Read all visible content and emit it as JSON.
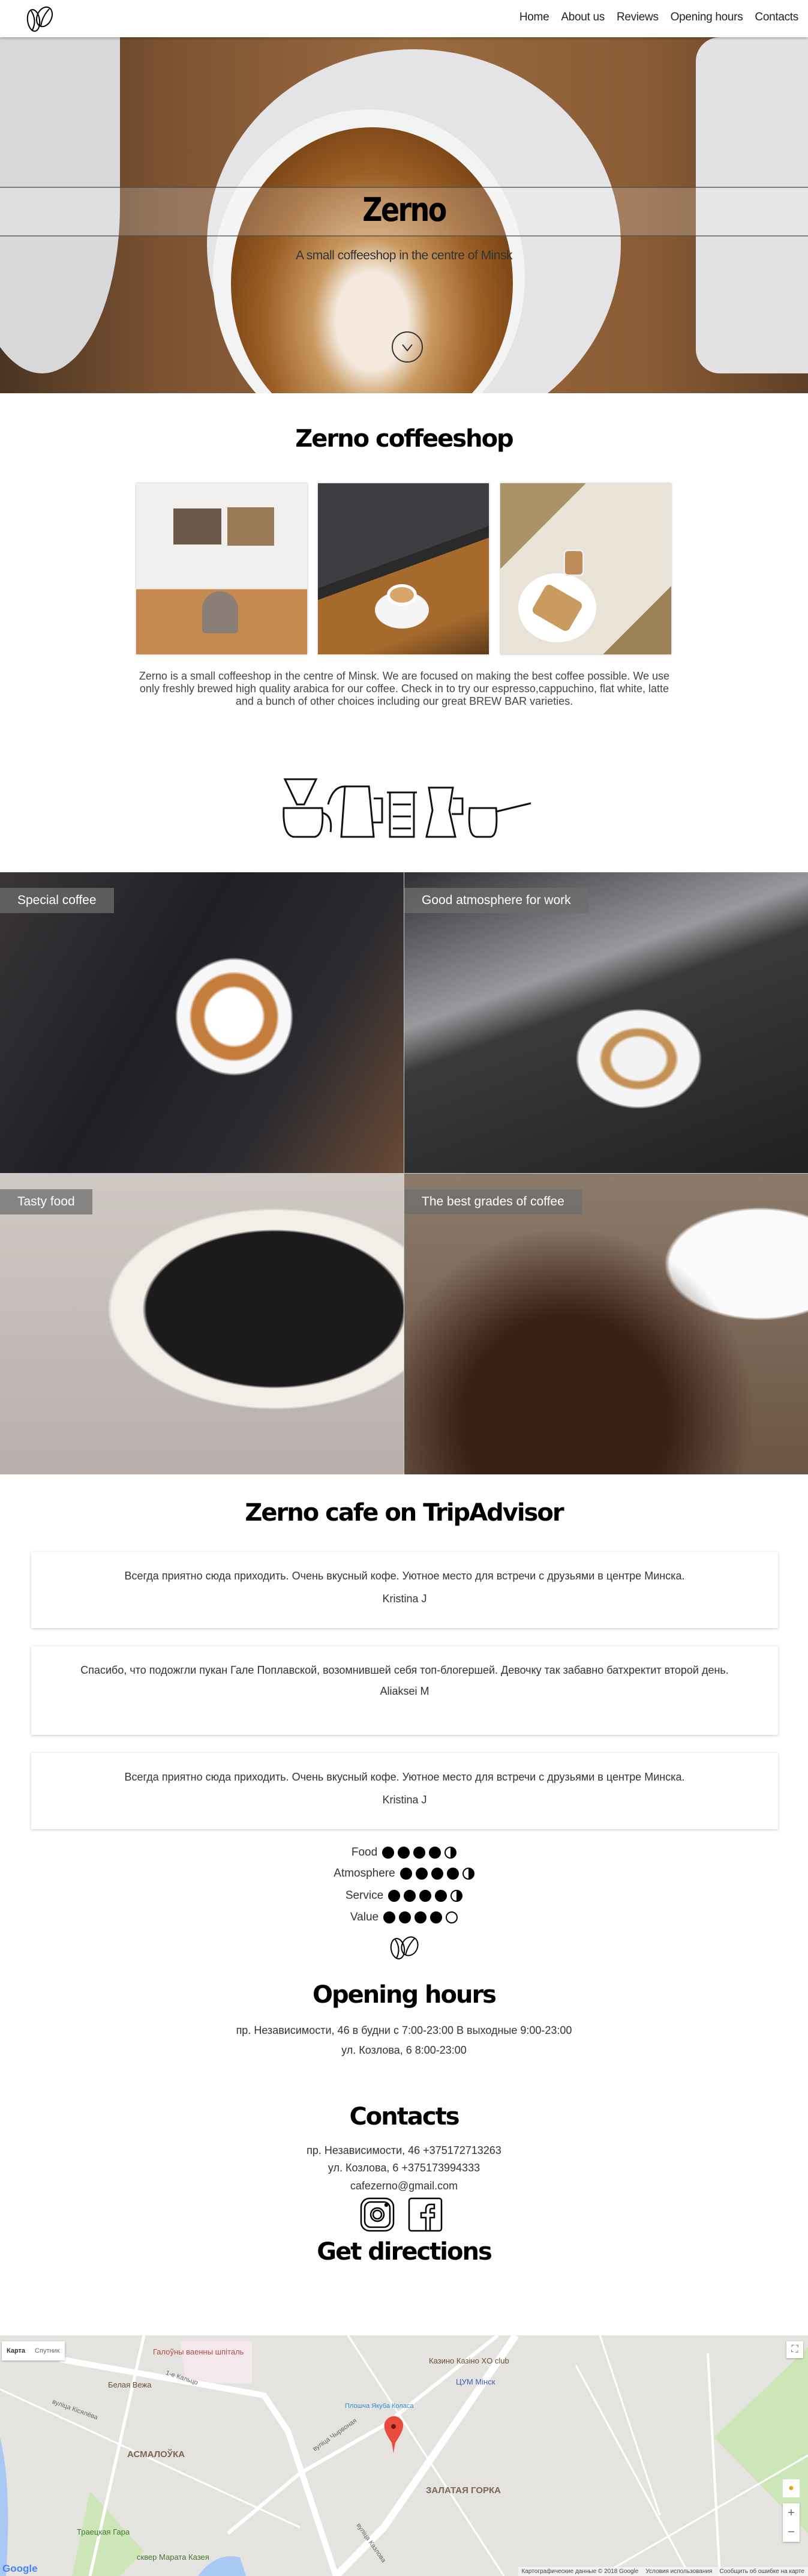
{
  "nav": {
    "logo": "coffee-bean-logo",
    "items": [
      "Home",
      "About us",
      "Reviews",
      "Opening hours",
      "Contacts"
    ]
  },
  "hero": {
    "title": "Zerno",
    "subtitle": "A small coffeeshop in the centre of Minsk",
    "scroll_icon": "chevron-down-circle-icon"
  },
  "about": {
    "title": "Zerno coffeeshop",
    "text": "Zerno is a small coffeeshop in the centre of Minsk. We are focused on making the best coffee possible. We use only freshly brewed high quality arabica for our coffee. Check in to try our espresso,cappuchino, flat white, latte and a bunch of other choices including our great BREW BAR varieties."
  },
  "features": [
    {
      "label": "Special coffee"
    },
    {
      "label": "Good atmosphere for work"
    },
    {
      "label": "Tasty food"
    },
    {
      "label": "The best grades of coffee"
    }
  ],
  "reviews": {
    "title": "Zerno cafe on TripAdvisor",
    "items": [
      {
        "text": "Всегда приятно сюда приходить. Очень вкусный кофе. Уютное место для встречи с друзьями в центре Минска.",
        "author": "Kristina J"
      },
      {
        "text": "Спасибо, что подожгли пукан Гале Поплавской, возомнившей себя топ-блогершей. Девочку так забавно батхректит второй день.",
        "author": "Aliaksei M"
      },
      {
        "text": "Всегда приятно сюда приходить. Очень вкусный кофе. Уютное место для встречи с друзьями в центре Минска.",
        "author": "Kristina J"
      }
    ],
    "ratings": [
      {
        "label": "Food",
        "value": 4.5,
        "max": 5
      },
      {
        "label": "Atmosphere",
        "value": 4.5,
        "max": 5
      },
      {
        "label": "Service",
        "value": 4.5,
        "max": 5
      },
      {
        "label": "Value",
        "value": 4,
        "max": 5
      }
    ]
  },
  "hours": {
    "title": "Opening hours",
    "lines": [
      "пр. Независимости, 46 в будни с 7:00-23:00 В выходные 9:00-23:00",
      "ул. Козлова, 6 8:00-23:00"
    ]
  },
  "contacts": {
    "title": "Contacts",
    "lines": [
      "пр. Независимости, 46 +375172713263",
      "ул. Козлова, 6 +375173994333",
      "cafezerno@gmail.com"
    ],
    "social": [
      "instagram-icon",
      "facebook-icon"
    ]
  },
  "directions": {
    "title": "Get directions",
    "map": {
      "type_map": "Карта",
      "type_satellite": "Спутник",
      "labels": [
        "Галоўны ваенны шпіталь",
        "Белая Вежа",
        "Казино Казіно XO club",
        "ЦУМ Мінск",
        "Плошча Якуба Коласа",
        "АСМАЛОЎКА",
        "ЗАЛАТАЯ ГОРКА",
        "Траецкая Гара",
        "сквер Марата Казея",
        "вуліца Кісялёва",
        "вуліца Чырвоная",
        "вуліца Казлова",
        "1-е Кальцо"
      ],
      "footer": [
        "Картографические данные © 2018 Google",
        "Условия использования",
        "Сообщить об ошибке на карте"
      ],
      "brand": "Google",
      "marker_color": "#e94b3c"
    }
  }
}
